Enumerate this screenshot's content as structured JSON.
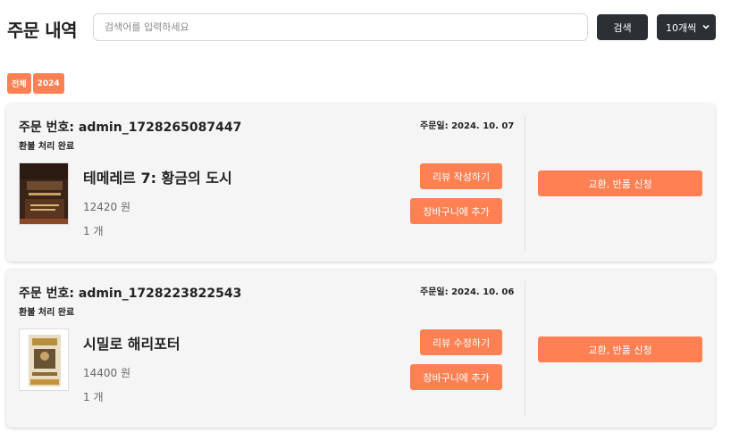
{
  "header": {
    "title": "주문 내역",
    "search_placeholder": "검색어를 입력하세요",
    "search_label": "검색",
    "page_size": "10개씩"
  },
  "filters": [
    "전체",
    "2024"
  ],
  "orders": [
    {
      "number": "주문 번호: admin_1728265087447",
      "status": "환불 처리 완료",
      "date": "주문일: 2024. 10. 07",
      "title": "테메레르 7: 황금의 도시",
      "price": "12420 원",
      "qty": "1 개",
      "review_label": "리뷰 작성하기",
      "cart_label": "장바구니에 추가",
      "exchange_label": "교환, 반품 신청"
    },
    {
      "number": "주문 번호: admin_1728223822543",
      "status": "환불 처리 완료",
      "date": "주문일: 2024. 10. 06",
      "title": "시밀로 해리포터",
      "price": "14400 원",
      "qty": "1 개",
      "review_label": "리뷰 수정하기",
      "cart_label": "장바구니에 추가",
      "exchange_label": "교환, 반품 신청"
    }
  ],
  "colors": {
    "accent": "#ff8052",
    "dark_button": "#2b3035",
    "card_bg": "#f5f5f5"
  }
}
